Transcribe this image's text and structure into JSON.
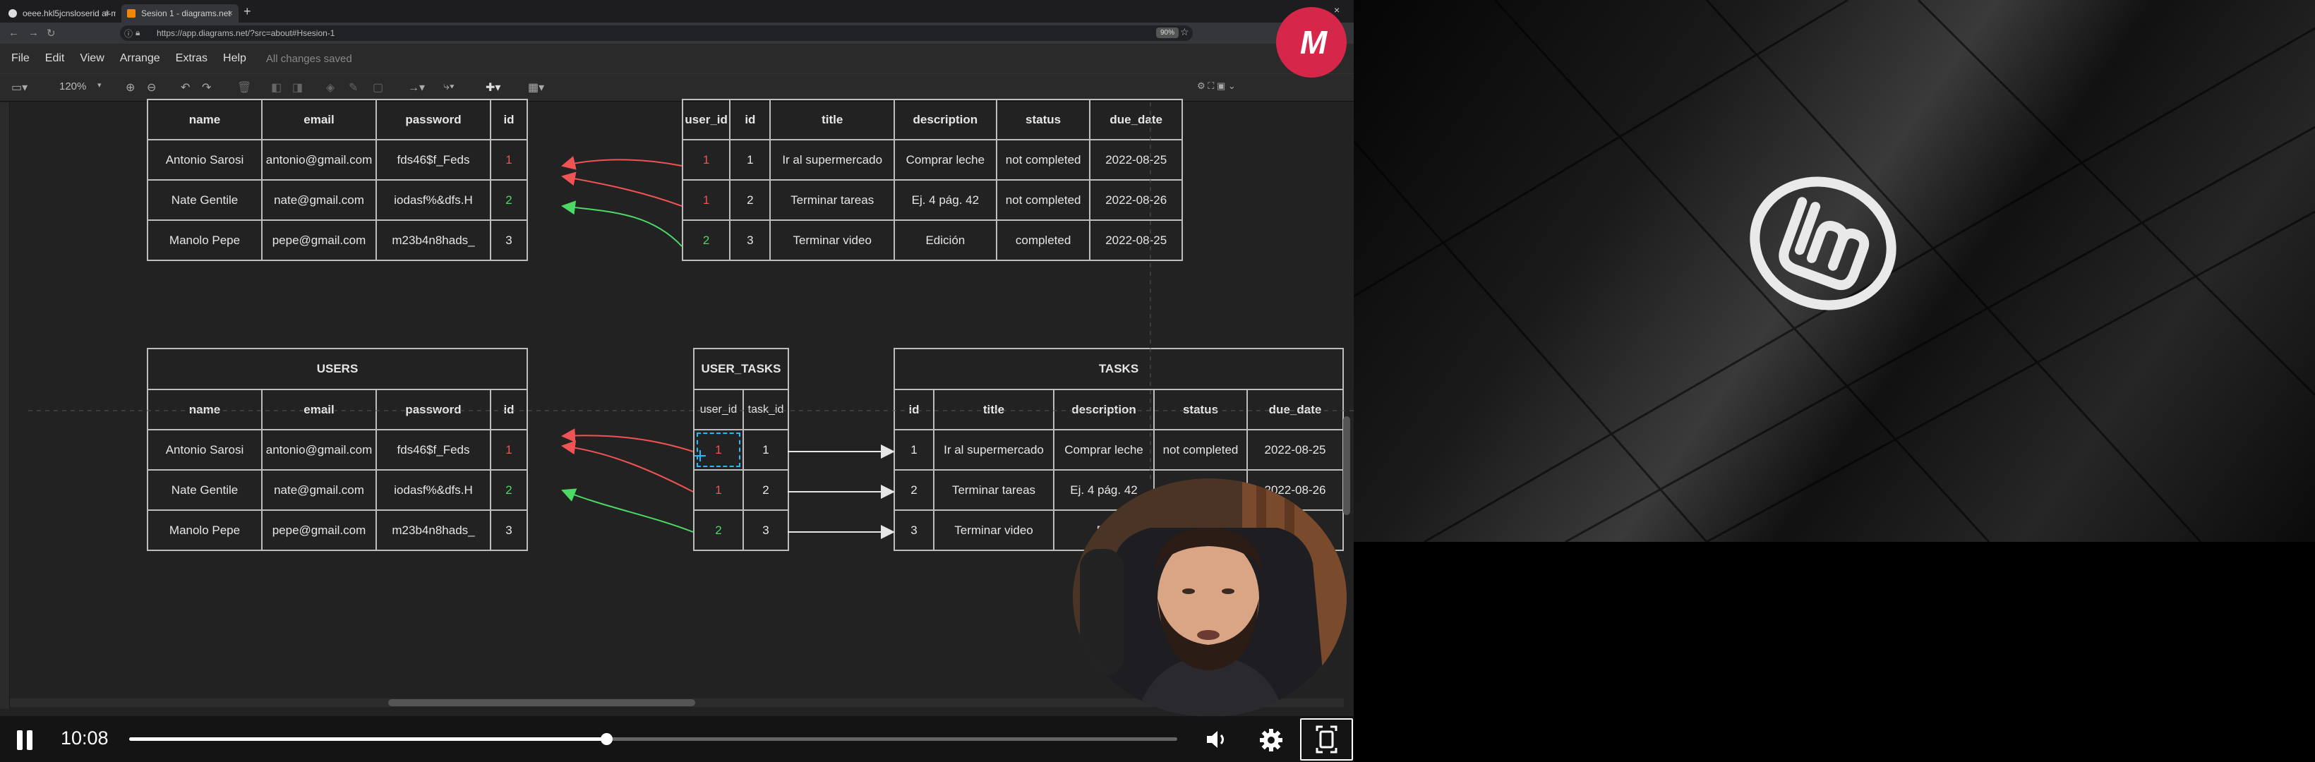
{
  "browser": {
    "tabs": [
      {
        "label": "oeee.hkl5jcnsloserid al-m",
        "active": false
      },
      {
        "label": "Sesion 1 - diagrams.net",
        "active": true
      }
    ],
    "url": "https://app.diagrams.net/?src=about#Hsesion-1",
    "zoom_chip": "90%"
  },
  "menu": {
    "items": [
      "File",
      "Edit",
      "View",
      "Arrange",
      "Extras",
      "Help"
    ],
    "status": "All changes saved"
  },
  "toolbar": {
    "zoom": "120%"
  },
  "diagram": {
    "top_users": {
      "columns": [
        "name",
        "email",
        "password",
        "id"
      ],
      "rows": [
        [
          "Antonio Sarosi",
          "antonio@gmail.com",
          "fds46$f_Feds",
          "1"
        ],
        [
          "Nate Gentile",
          "nate@gmail.com",
          "iodasf%&dfs.H",
          "2"
        ],
        [
          "Manolo Pepe",
          "pepe@gmail.com",
          "m23b4n8hads_",
          "3"
        ]
      ]
    },
    "top_tasks": {
      "columns": [
        "user_id",
        "id",
        "title",
        "description",
        "status",
        "due_date"
      ],
      "rows": [
        [
          "1",
          "1",
          "Ir al supermercado",
          "Comprar leche",
          "not completed",
          "2022-08-25"
        ],
        [
          "1",
          "2",
          "Terminar tareas",
          "Ej. 4 pág. 42",
          "not completed",
          "2022-08-26"
        ],
        [
          "2",
          "3",
          "Terminar video",
          "Edición",
          "completed",
          "2022-08-25"
        ]
      ]
    },
    "users": {
      "title": "USERS",
      "columns": [
        "name",
        "email",
        "password",
        "id"
      ],
      "rows": [
        [
          "Antonio Sarosi",
          "antonio@gmail.com",
          "fds46$f_Feds",
          "1"
        ],
        [
          "Nate Gentile",
          "nate@gmail.com",
          "iodasf%&dfs.H",
          "2"
        ],
        [
          "Manolo Pepe",
          "pepe@gmail.com",
          "m23b4n8hads_",
          "3"
        ]
      ]
    },
    "user_tasks": {
      "title": "USER_TASKS",
      "columns": [
        "user_id",
        "task_id"
      ],
      "rows": [
        [
          "1",
          "1"
        ],
        [
          "1",
          "2"
        ],
        [
          "2",
          "3"
        ]
      ]
    },
    "tasks": {
      "title": "TASKS",
      "columns": [
        "id",
        "title",
        "description",
        "status",
        "due_date"
      ],
      "rows": [
        [
          "1",
          "Ir al supermercado",
          "Comprar leche",
          "not completed",
          "2022-08-25"
        ],
        [
          "2",
          "Terminar tareas",
          "Ej. 4 pág. 42",
          "not completed",
          "2022-08-26"
        ],
        [
          "3",
          "Terminar video",
          "Ed",
          "",
          "25"
        ]
      ]
    }
  },
  "player": {
    "time": "10:08",
    "progress": 0.455,
    "state": "playing"
  },
  "colors": {
    "red_fk": "#f05353",
    "green_fk": "#4cd964",
    "selection": "#29b6f6",
    "brand": "#d6264a"
  },
  "icons": [
    "pause-icon",
    "volume-icon",
    "settings-gear-icon",
    "fullscreen-icon",
    "linux-mint-logo-icon"
  ]
}
